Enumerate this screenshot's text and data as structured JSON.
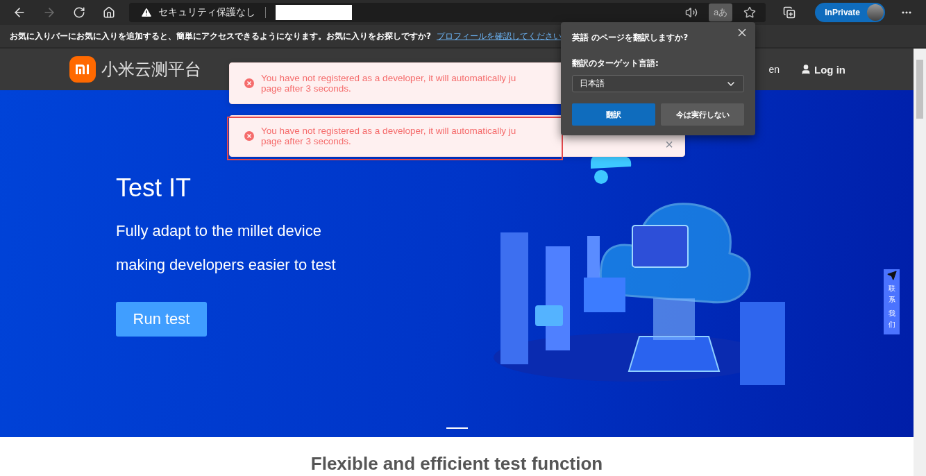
{
  "browser": {
    "nav": [
      {
        "kind": "back",
        "disabled": false
      },
      {
        "kind": "forward",
        "disabled": true
      },
      {
        "kind": "refresh",
        "disabled": false
      },
      {
        "kind": "home",
        "disabled": false
      }
    ],
    "security_label": "セキュリティ保護なし",
    "tools": [
      {
        "kind": "read-aloud",
        "selected": false
      },
      {
        "kind": "translate",
        "selected": true,
        "label": "aあ"
      },
      {
        "kind": "add-favorite",
        "selected": false
      }
    ],
    "inprivate": "InPrivate"
  },
  "favorites_bar": {
    "message": "お気に入りバーにお気に入りを追加すると、簡単にアクセスできるようになります。お気に入りをお探しですか?",
    "link": "プロフィールを確認してください"
  },
  "site": {
    "logo_text": "小米云测平台",
    "language": "en",
    "login": "Log in"
  },
  "hero": {
    "title": "Test IT",
    "lines": [
      "Fully adapt to the millet device",
      "making developers easier to test"
    ],
    "button": "Run test"
  },
  "contact": {
    "lines": [
      "联系",
      "我们"
    ]
  },
  "section_heading": "Flexible and efficient test function",
  "toasts": [
    {
      "lines": [
        "You have not registered as a developer, it will automatically ju",
        "page after 3 seconds."
      ],
      "highlighted": false
    },
    {
      "lines": [
        "You have not registered as a developer, it will automatically ju",
        "page after 3 seconds."
      ],
      "highlighted": true,
      "close": "×"
    }
  ],
  "translate_popup": {
    "title": "英語 のページを翻訳しますか?",
    "label": "翻訳のターゲット言語:",
    "language": "日本語",
    "buttons": [
      {
        "label": "翻訳",
        "primary": true
      },
      {
        "label": "今は実行しない",
        "primary": false
      }
    ]
  }
}
